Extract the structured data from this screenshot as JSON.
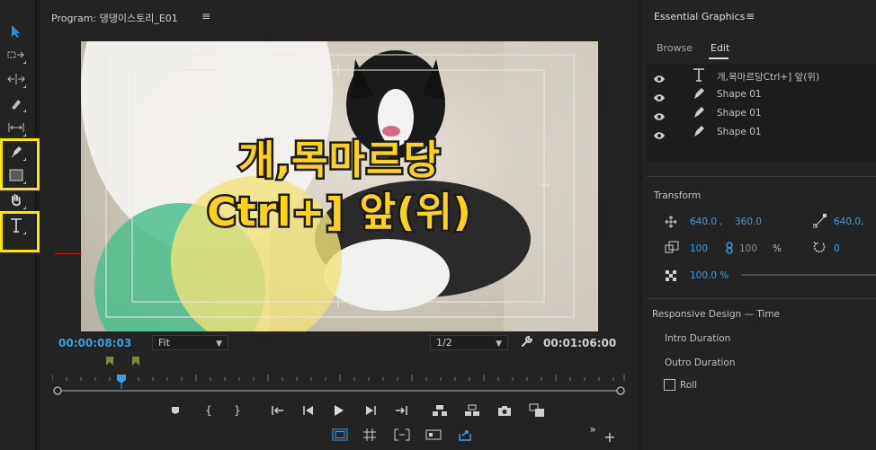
{
  "program": {
    "title": "Program: 댕댕이스토리_E01",
    "menu_glyph": "≡",
    "current_timecode": "00:00:08:03",
    "fit_value": "Fit",
    "resolution_value": "1/2",
    "duration_timecode": "00:01:06:00",
    "title_line1": "개,목마르당",
    "title_line2": "Ctrl+] 앞(위)"
  },
  "essential_graphics": {
    "title": "Essential Graphics",
    "menu_glyph": "≡",
    "tabs": [
      "Browse",
      "Edit"
    ],
    "active_tab": "Edit",
    "layers": [
      {
        "type": "text",
        "name": "개,목마르당Ctrl+] 앞(위)",
        "icon": "text-tool-icon"
      },
      {
        "type": "shape",
        "name": "Shape 01",
        "icon": "pen-icon"
      },
      {
        "type": "shape",
        "name": "Shape 01",
        "icon": "pen-icon"
      },
      {
        "type": "shape",
        "name": "Shape 01",
        "icon": "pen-icon"
      }
    ],
    "transform": {
      "label": "Transform",
      "position_x": "640.0",
      "position_sep": ",",
      "position_y": "360.0",
      "anchor_x": "640.0",
      "anchor_sep": ",",
      "scale": "100",
      "scale_linked": "100",
      "scale_unit": "%",
      "rotation": "0",
      "opacity": "100.0 %"
    },
    "responsive": {
      "label": "Responsive Design — Time",
      "intro": "Intro Duration",
      "outro": "Outro Duration",
      "roll_label": "Roll"
    }
  },
  "colors": {
    "accent_blue": "#3d9ee5",
    "highlight_yellow": "#ffe600",
    "panel_bg": "#232323"
  }
}
